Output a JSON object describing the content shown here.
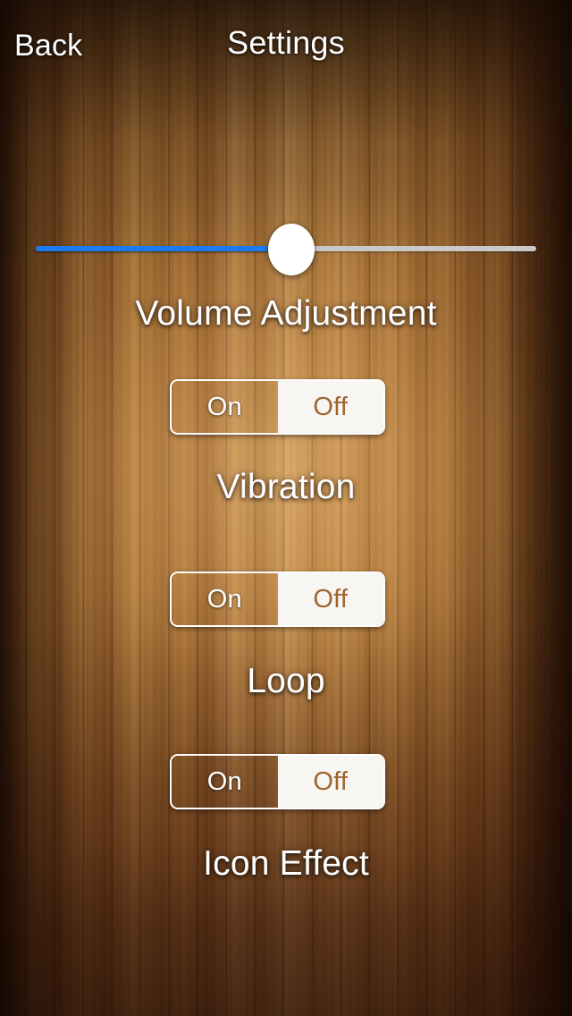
{
  "header": {
    "back_label": "Back",
    "title": "Settings"
  },
  "volume": {
    "label": "Volume Adjustment",
    "value_percent": 51,
    "fill_color": "#1a7cf0",
    "track_color": "#c9c9c9",
    "thumb_color": "#ffffff"
  },
  "settings": [
    {
      "name": "vibration",
      "label": "Vibration",
      "options": [
        "On",
        "Off"
      ],
      "selected": "On"
    },
    {
      "name": "loop",
      "label": "Loop",
      "options": [
        "On",
        "Off"
      ],
      "selected": "On"
    },
    {
      "name": "icon_effect",
      "label": "Icon Effect",
      "options": [
        "On",
        "Off"
      ],
      "selected": "On"
    }
  ],
  "colors": {
    "label_text": "#ffffff",
    "segment_border": "#ffffff",
    "segment_filled_bg": "#f7f6f3",
    "segment_filled_text": "#a0652e",
    "background_wood_light": "#c08f52",
    "background_wood_dark": "#4a2810"
  }
}
